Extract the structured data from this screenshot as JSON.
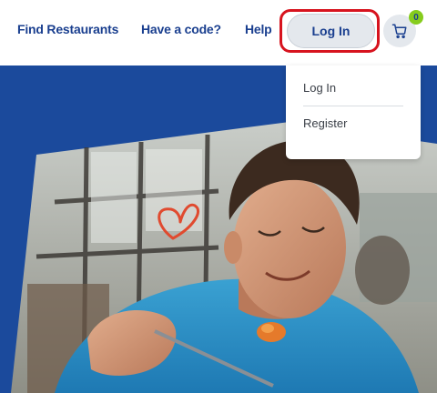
{
  "header": {
    "nav": {
      "find_restaurants": "Find Restaurants",
      "have_a_code": "Have a code?",
      "help": "Help"
    },
    "login_label": "Log In",
    "cart": {
      "icon": "cart-icon",
      "count": "0"
    }
  },
  "dropdown": {
    "items": [
      {
        "label": "Log In"
      },
      {
        "label": "Register"
      }
    ]
  },
  "colors": {
    "brand_blue": "#1a3f8f",
    "hero_blue": "#1b4a9c",
    "highlight_red": "#d7131e",
    "badge_green": "#86cc1d"
  }
}
